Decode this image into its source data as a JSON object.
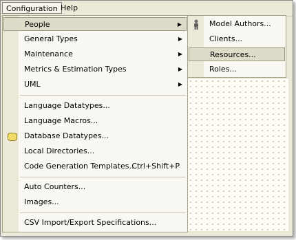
{
  "menubar": {
    "items": [
      "Configuration",
      "Help"
    ]
  },
  "config_menu": {
    "group1": [
      "People",
      "General Types",
      "Maintenance",
      "Metrics & Estimation Types",
      "UML"
    ],
    "group2": [
      "Language Datatypes...",
      "Language Macros...",
      "Database Datatypes...",
      "Local Directories...",
      "Code Generation Templates..."
    ],
    "shortcut_codegen": "Ctrl+Shift+P",
    "group3": [
      "Auto Counters...",
      "Images..."
    ],
    "group4": [
      "CSV Import/Export Specifications..."
    ]
  },
  "people_menu": {
    "items": [
      "Model Authors...",
      "Clients...",
      "Resources...",
      "Roles..."
    ]
  },
  "icons": {
    "database": "database-icon",
    "person": "person-icon",
    "submenu_arrow": "submenu-arrow-icon"
  },
  "colors": {
    "highlight": "#dedcc8",
    "menu_background": "#f9f8f3",
    "gutter": "#ece9d8"
  }
}
